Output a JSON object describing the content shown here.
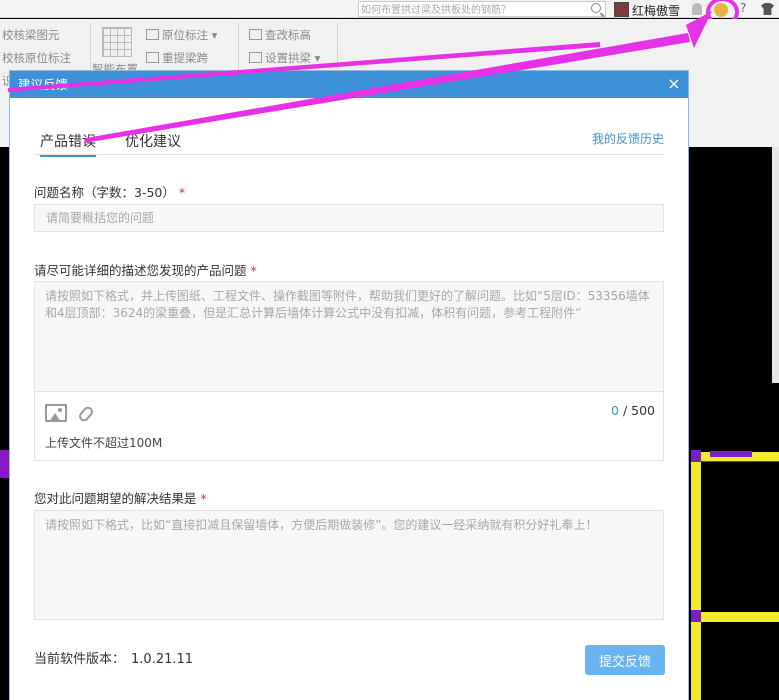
{
  "topbar": {
    "search_placeholder": "如何布置拱过梁及拱板处的钢筋？",
    "user_name": "红梅傲雪",
    "help_label": "?"
  },
  "ribbon": {
    "item1": "校核梁图元",
    "item2": "校核原位标注",
    "item3": "原位标注",
    "item4": "重提梁跨",
    "item5": "查改标高",
    "item6": "设置拱梁",
    "item7": "智能布置",
    "item8": "识"
  },
  "dialog": {
    "title": "建议反馈",
    "close": "×",
    "tabs": [
      {
        "label": "产品错误",
        "active": true
      },
      {
        "label": "优化建议",
        "active": false
      }
    ],
    "history_link": "我的反馈历史",
    "title_field": {
      "label": "问题名称（字数：3-50）",
      "required_mark": "*",
      "placeholder": "请简要概括您的问题"
    },
    "description_field": {
      "label": "请尽可能详细的描述您发现的产品问题",
      "required_mark": "*",
      "placeholder": "请按照如下格式，并上传图纸、工程文件、操作截图等附件，帮助我们更好的了解问题。比如“5层ID：53356墙体和4层顶部：3624的梁重叠，但是汇总计算后墙体计算公式中没有扣减，体积有问题，参考工程附件”",
      "char_count": "0",
      "char_sep": "/",
      "char_max": "500",
      "upload_note": "上传文件不超过100M"
    },
    "expectation_field": {
      "label": "您对此问题期望的解决结果是",
      "required_mark": "*",
      "placeholder": "请按照如下格式，比如“直接扣减且保留墙体，方便后期做装修”。您的建议一经采纳就有积分好礼奉上！"
    },
    "version_label": "当前软件版本：",
    "version_value": "1.0.21.11",
    "submit_label": "提交反馈"
  },
  "colors": {
    "accent": "#3d91d8",
    "annotation": "#e632e6",
    "submit": "#68b3f0"
  }
}
